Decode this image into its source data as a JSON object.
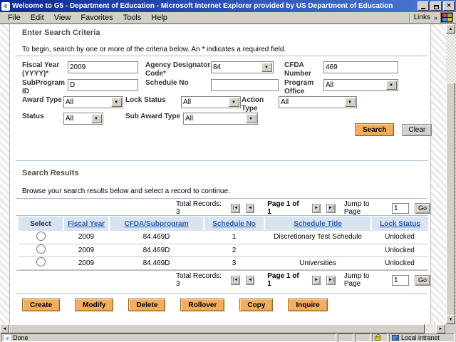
{
  "window": {
    "title": "Welcome to G5 - Department of Education - Microsoft Internet Explorer provided by US Department of Education"
  },
  "menu": {
    "items": [
      "File",
      "Edit",
      "View",
      "Favorites",
      "Tools",
      "Help"
    ],
    "links_label": "Links",
    "links_chevron": "»"
  },
  "icons": {
    "app_logo": "e",
    "close": "×",
    "scroll_up": "▲",
    "scroll_down": "▼",
    "scroll_left": "◄",
    "scroll_right": "►",
    "pager_first": "|◄",
    "pager_prev": "◄",
    "pager_next": "►",
    "pager_last": "►|"
  },
  "criteria": {
    "title": "Enter Search Criteria",
    "intro_before": "To begin, search by one or more of the criteria below. An ",
    "required_marker": "*",
    "intro_after": " indicates a required field.",
    "fields": {
      "fiscal_year": {
        "label": "Fiscal Year (YYYY)",
        "required": "*",
        "value": "2009"
      },
      "agency_designator": {
        "label": "Agency Designator Code",
        "required": "*",
        "value": "84"
      },
      "cfda_number": {
        "label": "CFDA Number",
        "value": "469"
      },
      "subprogram_id": {
        "label": "SubProgram ID",
        "value": "D"
      },
      "schedule_no": {
        "label": "Schedule No",
        "value": ""
      },
      "program_office": {
        "label": "Program Office",
        "value": "All"
      },
      "award_type": {
        "label": "Award Type",
        "value": "All"
      },
      "lock_status": {
        "label": "Lock Status",
        "value": "All"
      },
      "action_type": {
        "label": "Action Type",
        "value": "All"
      },
      "status": {
        "label": "Status",
        "value": "All"
      },
      "sub_award_type": {
        "label": "Sub Award Type",
        "value": "All"
      }
    },
    "search_label": "Search",
    "clear_label": "Clear"
  },
  "results": {
    "title": "Search Results",
    "intro": "Browse your search results below and select a record to continue.",
    "pagination": {
      "total": "Total Records: 3",
      "page": "Page 1 of 1",
      "jump_label": "Jump to Page",
      "jump_value": "1",
      "go_label": "Go"
    },
    "table": {
      "headers": [
        "Select",
        "Fiscal Year",
        "CFDA/Subprogram",
        "Schedule No",
        "Schedule Title",
        "Lock Status"
      ],
      "rows": [
        [
          "2009",
          "84.469D",
          "1",
          "Discretionary Test Schedule",
          "Unlocked"
        ],
        [
          "2009",
          "84.469D",
          "2",
          "",
          "Unlocked"
        ],
        [
          "2009",
          "84.469D",
          "3",
          "Universities",
          "Unlocked"
        ]
      ]
    },
    "actions": [
      "Create",
      "Modify",
      "Delete",
      "Rollover",
      "Copy",
      "Inquire"
    ]
  },
  "status_bar": {
    "status": "Done",
    "zone": "Local intranet"
  },
  "colors": {
    "accent_button": "#f4ad5c",
    "titlebar_start": "#0d2a96",
    "titlebar_end": "#4b79d4",
    "link": "#2a5db0",
    "table_header_bg": "#d9e4f1",
    "rule": "#a3bedd"
  }
}
